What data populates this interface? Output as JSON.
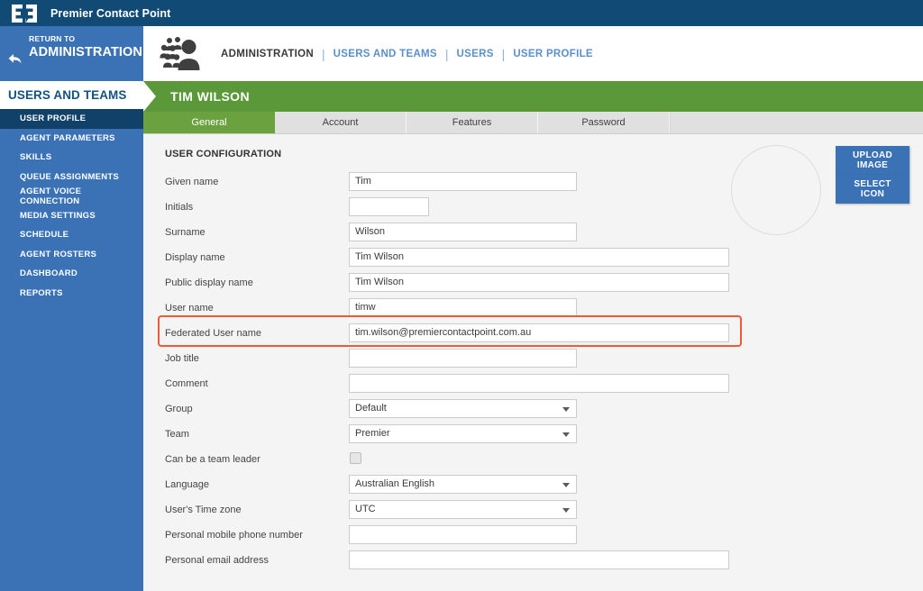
{
  "topbar": {
    "brand": "Premier Contact Point",
    "logo_icon": "premier-logo-icon",
    "bg": "#124a76"
  },
  "sidebar": {
    "return": {
      "small_label": "RETURN TO",
      "big_label": "ADMINISTRATION",
      "icon": "back-arrow-icon"
    },
    "section_title": "USERS AND TEAMS",
    "items": [
      {
        "label": "USER PROFILE",
        "active": true
      },
      {
        "label": "AGENT PARAMETERS",
        "active": false
      },
      {
        "label": "SKILLS",
        "active": false
      },
      {
        "label": "QUEUE ASSIGNMENTS",
        "active": false
      },
      {
        "label": "AGENT VOICE CONNECTION",
        "active": false
      },
      {
        "label": "MEDIA SETTINGS",
        "active": false
      },
      {
        "label": "SCHEDULE",
        "active": false
      },
      {
        "label": "AGENT ROSTERS",
        "active": false
      },
      {
        "label": "DASHBOARD",
        "active": false
      },
      {
        "label": "REPORTS",
        "active": false
      }
    ],
    "bg": "#3a72b5",
    "active_bg": "#114069"
  },
  "breadcrumb": {
    "icon": "users-group-icon",
    "root": "ADMINISTRATION",
    "separator": "|",
    "links": [
      "USERS AND TEAMS",
      "USERS",
      "USER PROFILE"
    ]
  },
  "page_header": {
    "title": "TIM WILSON",
    "bg": "#5b9839"
  },
  "tabs": [
    {
      "label": "General",
      "active": true
    },
    {
      "label": "Account",
      "active": false
    },
    {
      "label": "Features",
      "active": false
    },
    {
      "label": "Password",
      "active": false
    }
  ],
  "form": {
    "section_title": "USER CONFIGURATION",
    "fields": [
      {
        "label": "Given name",
        "value": "Tim",
        "type": "text",
        "width": "short"
      },
      {
        "label": "Initials",
        "value": "",
        "type": "text",
        "width": "tiny"
      },
      {
        "label": "Surname",
        "value": "Wilson",
        "type": "text",
        "width": "short"
      },
      {
        "label": "Display name",
        "value": "Tim Wilson",
        "type": "text",
        "width": "long"
      },
      {
        "label": "Public display name",
        "value": "Tim Wilson",
        "type": "text",
        "width": "long"
      },
      {
        "label": "User name",
        "value": "timw",
        "type": "text",
        "width": "short"
      },
      {
        "label": "Federated User name",
        "value": "tim.wilson@premiercontactpoint.com.au",
        "type": "text",
        "width": "long",
        "highlighted": true
      },
      {
        "label": "Job title",
        "value": "",
        "type": "text",
        "width": "short"
      },
      {
        "label": "Comment",
        "value": "",
        "type": "text",
        "width": "long"
      },
      {
        "label": "Group",
        "value": "Default",
        "type": "select",
        "width": "short"
      },
      {
        "label": "Team",
        "value": "Premier",
        "type": "select",
        "width": "short"
      },
      {
        "label": "Can be a team leader",
        "value": "",
        "type": "checkbox",
        "checked": false
      },
      {
        "label": "Language",
        "value": "Australian English",
        "type": "select",
        "width": "short"
      },
      {
        "label": "User's Time zone",
        "value": "UTC",
        "type": "select",
        "width": "short"
      },
      {
        "label": "Personal mobile phone number",
        "value": "",
        "type": "text",
        "width": "short"
      },
      {
        "label": "Personal email address",
        "value": "",
        "type": "text",
        "width": "long"
      }
    ],
    "highlight_color": "#f05a32"
  },
  "avatar": {
    "placeholder": "empty-avatar-circle",
    "upload_button": "UPLOAD IMAGE",
    "select_button": "SELECT ICON",
    "button_bg": "#3a72b5"
  }
}
